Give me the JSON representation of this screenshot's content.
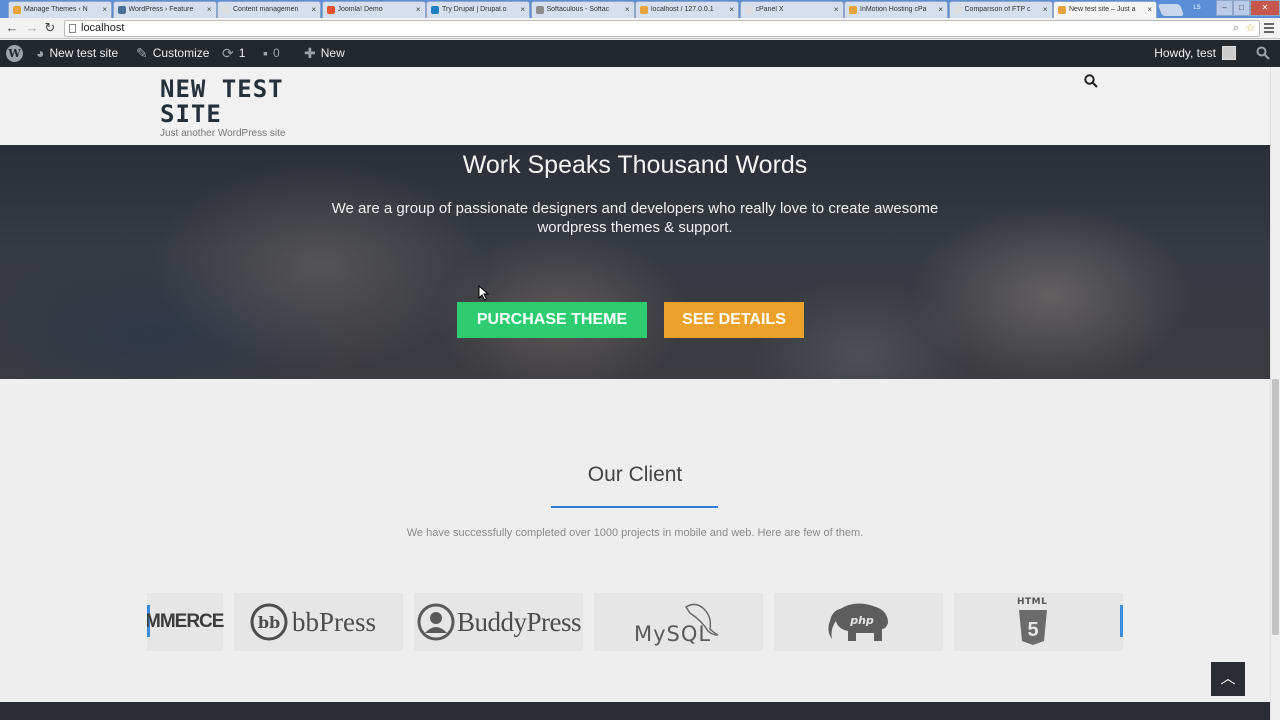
{
  "browser": {
    "tabs": [
      {
        "title": "Manage Themes ‹ N",
        "fav": "#e8a33a"
      },
      {
        "title": "WordPress › Feature",
        "fav": "#4a6f99"
      },
      {
        "title": "Content managemen",
        "fav": "#dddddd"
      },
      {
        "title": "Joomla! Demo",
        "fav": "#e2522e"
      },
      {
        "title": "Try Drupal | Drupal.o",
        "fav": "#1e7fc1"
      },
      {
        "title": "Softaculous - Softac",
        "fav": "#8d8d8d"
      },
      {
        "title": "localhost / 127.0.0.1",
        "fav": "#e6a23c"
      },
      {
        "title": "cPanel X",
        "fav": "#dddddd"
      },
      {
        "title": "InMotion Hosting cPa",
        "fav": "#e6a23c"
      },
      {
        "title": "Comparison of FTP c",
        "fav": "#dddddd"
      },
      {
        "title": "New test site – Just a",
        "fav": "#e6a23c"
      }
    ],
    "active_tab": 10,
    "url": "localhost",
    "user_initials": "LS"
  },
  "adminbar": {
    "site_name": "New test site",
    "customize": "Customize",
    "updates_count": "1",
    "comments_count": "0",
    "new_label": "New",
    "howdy": "Howdy, test"
  },
  "site": {
    "title": "NEW TEST SITE",
    "tagline": "Just another WordPress site"
  },
  "hero": {
    "title": "Work Speaks Thousand Words",
    "text": "We are a group of passionate designers and developers who really love to create awesome wordpress themes & support.",
    "purchase_label": "PURCHASE THEME",
    "details_label": "SEE DETAILS",
    "purchase_color": "#2ecc71",
    "details_color": "#eca12a"
  },
  "clients": {
    "title": "Our Client",
    "subtitle": "We have successfully completed over 1000 projects in mobile and web. Here are few of them.",
    "accent": "#2f7fd6",
    "logos": [
      {
        "name": "woocommerce",
        "text": "MMERCE"
      },
      {
        "name": "bbpress",
        "text": "bbPress"
      },
      {
        "name": "buddypress",
        "text": "BuddyPress"
      },
      {
        "name": "mysql",
        "text": "MySQL"
      },
      {
        "name": "php",
        "text": "php"
      },
      {
        "name": "html5",
        "text": "HTML",
        "num": "5"
      }
    ]
  },
  "ui": {
    "back_to_top_icon": "chevron-up-icon"
  }
}
